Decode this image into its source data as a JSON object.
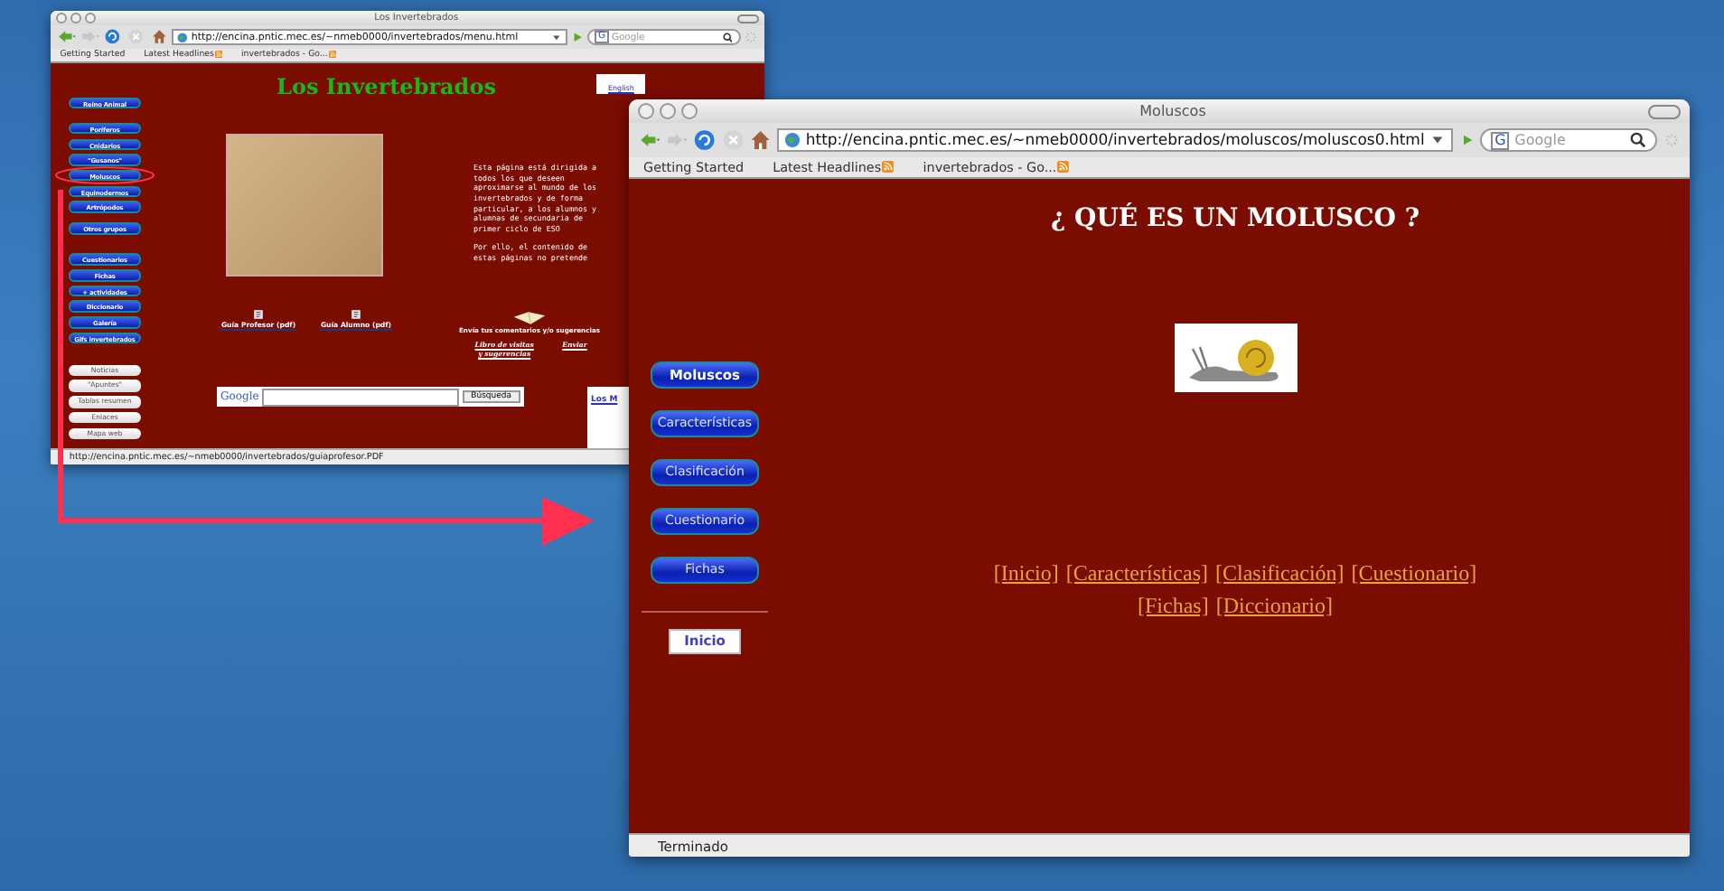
{
  "windows": [
    {
      "kind": "menu",
      "title": "Los Invertebrados",
      "url": "http://encina.pntic.mec.es/~nmeb0000/invertebrados/menu.html",
      "search_engine_mark": "G",
      "search_placeholder": "Google",
      "bookmarks": [
        {
          "label": "Getting Started",
          "feed": false
        },
        {
          "label": "Latest Headlines",
          "feed": true
        },
        {
          "label": "invertebrados - Go...",
          "feed": true
        }
      ],
      "status": "http://encina.pntic.mec.es/~nmeb0000/invertebrados/guiaprofesor.PDF",
      "page": {
        "heading": "Los Invertebrados",
        "english_badge": "English",
        "nav_groups": [
          [
            {
              "label": "Reino Animal"
            }
          ],
          [
            {
              "label": "Poríferos",
              "circled": false
            },
            {
              "label": "Cnidarios",
              "circled": false
            },
            {
              "label": "\"Gusanos\"",
              "circled": false
            },
            {
              "label": "Moluscos",
              "circled": true
            },
            {
              "label": "Equinodermos",
              "circled": false
            },
            {
              "label": "Artrópodos",
              "circled": false
            }
          ],
          [
            {
              "label": "Otros grupos"
            }
          ],
          [
            {
              "label": "Cuestionarios"
            },
            {
              "label": "Fichas"
            },
            {
              "label": "+ actividades"
            },
            {
              "label": "Diccionario"
            },
            {
              "label": "Galería"
            },
            {
              "label": "Gifs invertebrados"
            }
          ]
        ],
        "white_buttons": [
          "Noticias",
          "\"Apuntes\"",
          "Tablas resumen",
          "Enlaces",
          "Mapa web"
        ],
        "intro_paragraphs": [
          "Esta página está dirigida a todos los que deseen aproximarse al mundo de los invertebrados y de forma particular, a los alumnos y alumnas de secundaria de primer ciclo de ESO",
          "Por ello, el contenido de estas páginas no pretende"
        ],
        "downloads": [
          "Guía Profesor (pdf)",
          "Guía Alumno (pdf)"
        ],
        "feedback": {
          "text": "Envía tus comentarios y/o sugerencias",
          "guestbook": "Libro de visitas y sugerencias",
          "send": "Enviar"
        },
        "search_logo": "Google",
        "search_button": "Búsqueda",
        "preview_title": "Los M"
      }
    },
    {
      "kind": "section",
      "title": "Moluscos",
      "url": "http://encina.pntic.mec.es/~nmeb0000/invertebrados/moluscos/moluscos0.html",
      "search_engine_mark": "G",
      "search_placeholder": "Google",
      "bookmarks": [
        {
          "label": "Getting Started",
          "feed": false
        },
        {
          "label": "Latest Headlines",
          "feed": true
        },
        {
          "label": "invertebrados - Go...",
          "feed": true
        }
      ],
      "status": "Terminado",
      "page": {
        "heading": "¿ QUÉ ES UN MOLUSCO ?",
        "nav_buttons": [
          {
            "label": "Moluscos",
            "selected": true
          },
          {
            "label": "Características",
            "selected": false
          },
          {
            "label": "Clasificación",
            "selected": false
          },
          {
            "label": "Cuestionario",
            "selected": false
          },
          {
            "label": "Fichas",
            "selected": false
          }
        ],
        "home_button": "Inicio",
        "links": [
          "[Inicio]",
          "[Características]",
          "[Clasificación]",
          "[Cuestionario]",
          "[Fichas]",
          "[Diccionario]"
        ]
      }
    }
  ]
}
